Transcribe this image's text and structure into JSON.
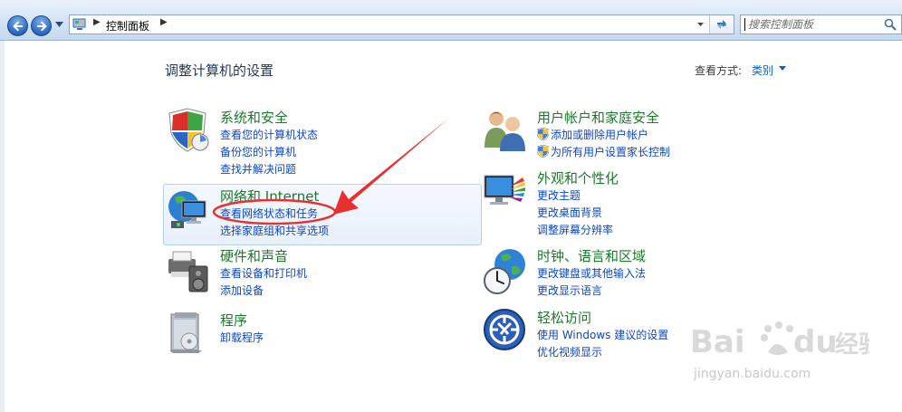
{
  "address_bar": {
    "breadcrumb": "控制面板",
    "search_placeholder": "搜索控制面板"
  },
  "header": {
    "title": "调整计算机的设置",
    "view_by_label": "查看方式:",
    "view_by_value": "类别"
  },
  "categories": {
    "system": {
      "title": "系统和安全",
      "links": [
        "查看您的计算机状态",
        "备份您的计算机",
        "查找并解决问题"
      ]
    },
    "network": {
      "title": "网络和 Internet",
      "links": [
        "查看网络状态和任务",
        "选择家庭组和共享选项"
      ]
    },
    "hardware": {
      "title": "硬件和声音",
      "links": [
        "查看设备和打印机",
        "添加设备"
      ]
    },
    "programs": {
      "title": "程序",
      "links": [
        "卸载程序"
      ]
    },
    "users": {
      "title": "用户帐户和家庭安全",
      "links": [
        "添加或删除用户帐户",
        "为所有用户设置家长控制"
      ]
    },
    "appearance": {
      "title": "外观和个性化",
      "links": [
        "更改主题",
        "更改桌面背景",
        "调整屏幕分辨率"
      ]
    },
    "clock": {
      "title": "时钟、语言和区域",
      "links": [
        "更改键盘或其他输入法",
        "更改显示语言"
      ]
    },
    "ease": {
      "title": "轻松访问",
      "links": [
        "使用 Windows 建议的设置",
        "优化视频显示"
      ]
    }
  },
  "watermark": {
    "domain": "jingyan.baidu.com"
  },
  "colors": {
    "category_title": "#1b7a2a",
    "link": "#0d47c9",
    "annotation": "#e8312f"
  }
}
